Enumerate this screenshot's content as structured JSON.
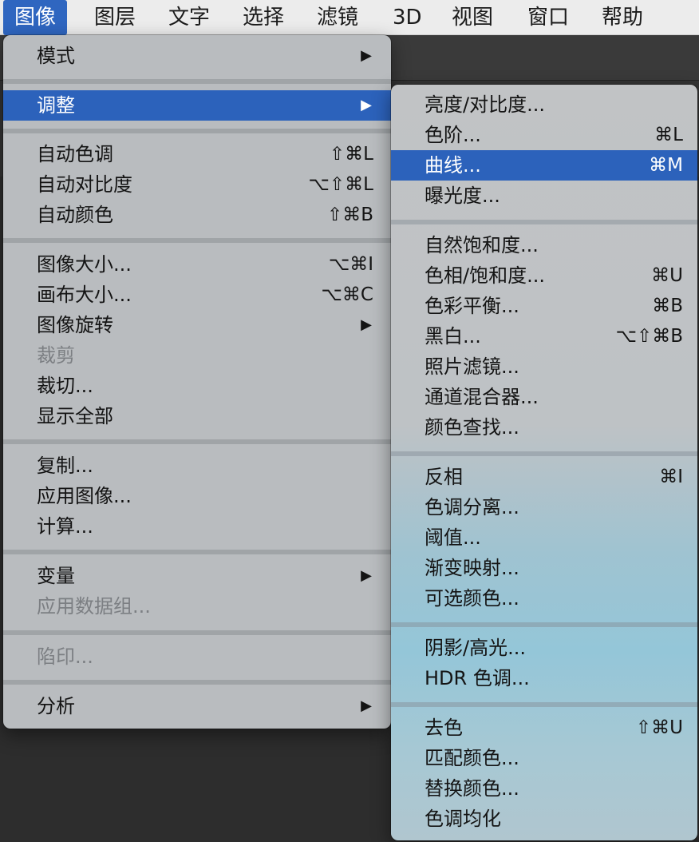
{
  "menubar": {
    "items": [
      {
        "label": "图像",
        "active": true
      },
      {
        "label": "图层"
      },
      {
        "label": "文字"
      },
      {
        "label": "选择"
      },
      {
        "label": "滤镜"
      },
      {
        "label": "3D"
      },
      {
        "label": "视图"
      },
      {
        "label": "窗口"
      },
      {
        "label": "帮助"
      }
    ]
  },
  "image_menu": {
    "items": [
      {
        "label": "模式",
        "submenu": true
      },
      {
        "label": "调整",
        "submenu": true,
        "highlighted": true
      },
      {
        "label": "自动色调",
        "shortcut": "⇧⌘L"
      },
      {
        "label": "自动对比度",
        "shortcut": "⌥⇧⌘L"
      },
      {
        "label": "自动颜色",
        "shortcut": "⇧⌘B"
      },
      {
        "label": "图像大小...",
        "shortcut": "⌥⌘I"
      },
      {
        "label": "画布大小...",
        "shortcut": "⌥⌘C"
      },
      {
        "label": "图像旋转",
        "submenu": true
      },
      {
        "label": "裁剪",
        "disabled": true
      },
      {
        "label": "裁切..."
      },
      {
        "label": "显示全部"
      },
      {
        "label": "复制..."
      },
      {
        "label": "应用图像..."
      },
      {
        "label": "计算..."
      },
      {
        "label": "变量",
        "submenu": true
      },
      {
        "label": "应用数据组...",
        "disabled": true
      },
      {
        "label": "陷印...",
        "disabled": true
      },
      {
        "label": "分析",
        "submenu": true
      }
    ],
    "submenu_arrow": "▶"
  },
  "adjust_submenu": {
    "items": [
      {
        "label": "亮度/对比度..."
      },
      {
        "label": "色阶...",
        "shortcut": "⌘L"
      },
      {
        "label": "曲线...",
        "shortcut": "⌘M",
        "highlighted": true
      },
      {
        "label": "曝光度..."
      },
      {
        "label": "自然饱和度..."
      },
      {
        "label": "色相/饱和度...",
        "shortcut": "⌘U"
      },
      {
        "label": "色彩平衡...",
        "shortcut": "⌘B"
      },
      {
        "label": "黑白...",
        "shortcut": "⌥⇧⌘B"
      },
      {
        "label": "照片滤镜..."
      },
      {
        "label": "通道混合器..."
      },
      {
        "label": "颜色查找..."
      },
      {
        "label": "反相",
        "shortcut": "⌘I"
      },
      {
        "label": "色调分离..."
      },
      {
        "label": "阈值..."
      },
      {
        "label": "渐变映射..."
      },
      {
        "label": "可选颜色..."
      },
      {
        "label": "阴影/高光..."
      },
      {
        "label": "HDR 色调..."
      },
      {
        "label": "去色",
        "shortcut": "⇧⌘U"
      },
      {
        "label": "匹配颜色..."
      },
      {
        "label": "替换颜色..."
      },
      {
        "label": "色调均化"
      }
    ]
  }
}
